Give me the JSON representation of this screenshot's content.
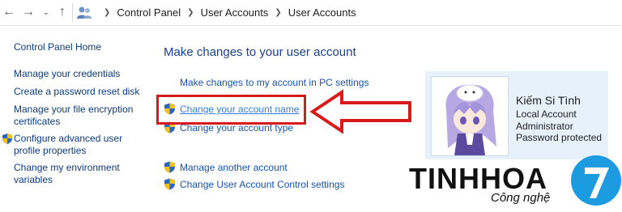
{
  "nav": {
    "back_icon": "back-arrow-icon",
    "forward_icon": "forward-arrow-icon",
    "recent_icon": "chevron-down-icon",
    "up_icon": "up-arrow-icon",
    "breadcrumbs": [
      "Control Panel",
      "User Accounts",
      "User Accounts"
    ]
  },
  "sidebar": {
    "home": "Control Panel Home",
    "items": [
      {
        "label": "Manage your credentials"
      },
      {
        "label": "Create a password reset disk"
      },
      {
        "label": "Manage your file encryption certificates"
      },
      {
        "label": "Configure advanced user profile properties",
        "icon": "uac-shield-icon"
      },
      {
        "label": "Change my environment variables"
      }
    ]
  },
  "main": {
    "title": "Make changes to your user account",
    "tasks": [
      {
        "label": "Make changes to my account in PC settings"
      },
      {
        "label": "Change your account name",
        "icon": "uac-shield-icon",
        "highlighted": true
      },
      {
        "label": "Change your account type",
        "icon": "uac-shield-icon"
      },
      {
        "label": "Manage another account",
        "icon": "uac-shield-icon"
      },
      {
        "label": "Change User Account Control settings",
        "icon": "uac-shield-icon"
      }
    ]
  },
  "account": {
    "name": "Kiếm Si Tình",
    "type": "Local Account",
    "role": "Administrator",
    "status": "Password protected"
  },
  "watermark": {
    "brand": "TINHHOA",
    "tagline": "Công nghệ",
    "logo_mark": "7"
  },
  "colors": {
    "highlight_box": "#d71a1a",
    "link": "#1453b3",
    "card_bg": "#e7f1fc",
    "logo_blue": "#1d9be0"
  }
}
